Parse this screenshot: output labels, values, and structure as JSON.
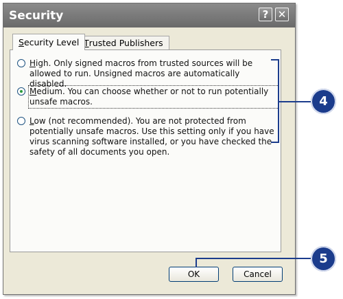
{
  "window": {
    "title": "Security",
    "help_glyph": "?",
    "close_glyph": "✕"
  },
  "tabs": [
    {
      "label_first": "S",
      "label_rest": "ecurity Level",
      "active": true
    },
    {
      "label_first": "T",
      "label_rest": "rusted Publishers",
      "active": false
    }
  ],
  "options": [
    {
      "first": "H",
      "rest": "igh. Only signed macros from trusted sources will be allowed to run. Unsigned macros are automatically disabled.",
      "checked": false
    },
    {
      "first": "M",
      "rest": "edium. You can choose whether or not to run potentially unsafe macros.",
      "checked": true
    },
    {
      "first": "L",
      "rest": "ow (not recommended). You are not protected from potentially unsafe macros. Use this setting only if you have virus scanning software installed, or you have checked the safety of all documents you open.",
      "checked": false
    }
  ],
  "buttons": {
    "ok": "OK",
    "cancel": "Cancel"
  },
  "callouts": {
    "options_step": "4",
    "ok_step": "5"
  },
  "colors": {
    "callout": "#1b3c8c",
    "titlebar": "#7a7a7a",
    "dialog_bg": "#ece9d8"
  }
}
